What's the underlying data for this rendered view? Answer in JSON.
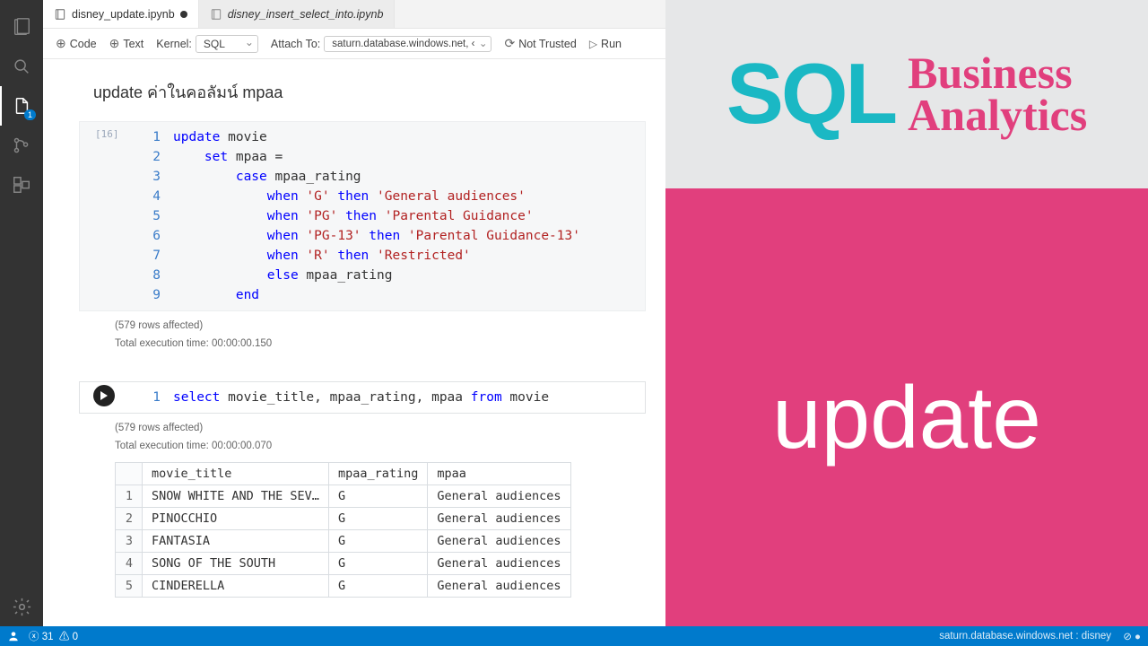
{
  "activity_badge": "1",
  "tabs": [
    {
      "label": "disney_update.ipynb",
      "active": true,
      "dirty": true
    },
    {
      "label": "disney_insert_select_into.ipynb",
      "active": false,
      "dirty": false
    }
  ],
  "toolbar": {
    "code": "Code",
    "text": "Text",
    "kernel_label": "Kernel:",
    "kernel_value": "SQL",
    "attach_label": "Attach To:",
    "attach_value": "saturn.database.windows.net, ‹",
    "trust": "Not Trusted",
    "run": "Run"
  },
  "heading": "update ค่าในคอลัมน์ mpaa",
  "cell1": {
    "exec": "[16]",
    "lines": [
      {
        "n": "1",
        "html": "<span class='kw'>update</span> movie"
      },
      {
        "n": "2",
        "html": "    <span class='kw'>set</span> mpaa ="
      },
      {
        "n": "3",
        "html": "        <span class='kw'>case</span> mpaa_rating"
      },
      {
        "n": "4",
        "html": "            <span class='kw'>when</span> <span class='str'>'G'</span> <span class='kw'>then</span> <span class='str'>'General audiences'</span>"
      },
      {
        "n": "5",
        "html": "            <span class='kw'>when</span> <span class='str'>'PG'</span> <span class='kw'>then</span> <span class='str'>'Parental Guidance'</span>"
      },
      {
        "n": "6",
        "html": "            <span class='kw'>when</span> <span class='str'>'PG-13'</span> <span class='kw'>then</span> <span class='str'>'Parental Guidance-13'</span>"
      },
      {
        "n": "7",
        "html": "            <span class='kw'>when</span> <span class='str'>'R'</span> <span class='kw'>then</span> <span class='str'>'Restricted'</span>"
      },
      {
        "n": "8",
        "html": "            <span class='kw'>else</span> mpaa_rating"
      },
      {
        "n": "9",
        "html": "        <span class='kw'>end</span>"
      }
    ],
    "rows_affected": "(579 rows affected)",
    "exec_time": "Total execution time: 00:00:00.150"
  },
  "cell2": {
    "line_n": "1",
    "line_html": "<span class='kw'>select</span> movie_title, mpaa_rating, mpaa <span class='kw'>from</span> movie",
    "rows_affected": "(579 rows affected)",
    "exec_time": "Total execution time: 00:00:00.070"
  },
  "table": {
    "headers": [
      "movie_title",
      "mpaa_rating",
      "mpaa"
    ],
    "rows": [
      [
        "1",
        "SNOW WHITE AND THE SEV…",
        "G",
        "General audiences"
      ],
      [
        "2",
        "PINOCCHIO",
        "G",
        "General audiences"
      ],
      [
        "3",
        "FANTASIA",
        "G",
        "General audiences"
      ],
      [
        "4",
        "SONG OF THE SOUTH",
        "G",
        "General audiences"
      ],
      [
        "5",
        "CINDERELLA",
        "G",
        "General audiences"
      ]
    ]
  },
  "rhs": {
    "sql": "SQL",
    "line1": "Business",
    "line2": "Analytics",
    "big": "update"
  },
  "status": {
    "errors": "31",
    "warnings": "0",
    "right": "saturn.database.windows.net : disney"
  }
}
